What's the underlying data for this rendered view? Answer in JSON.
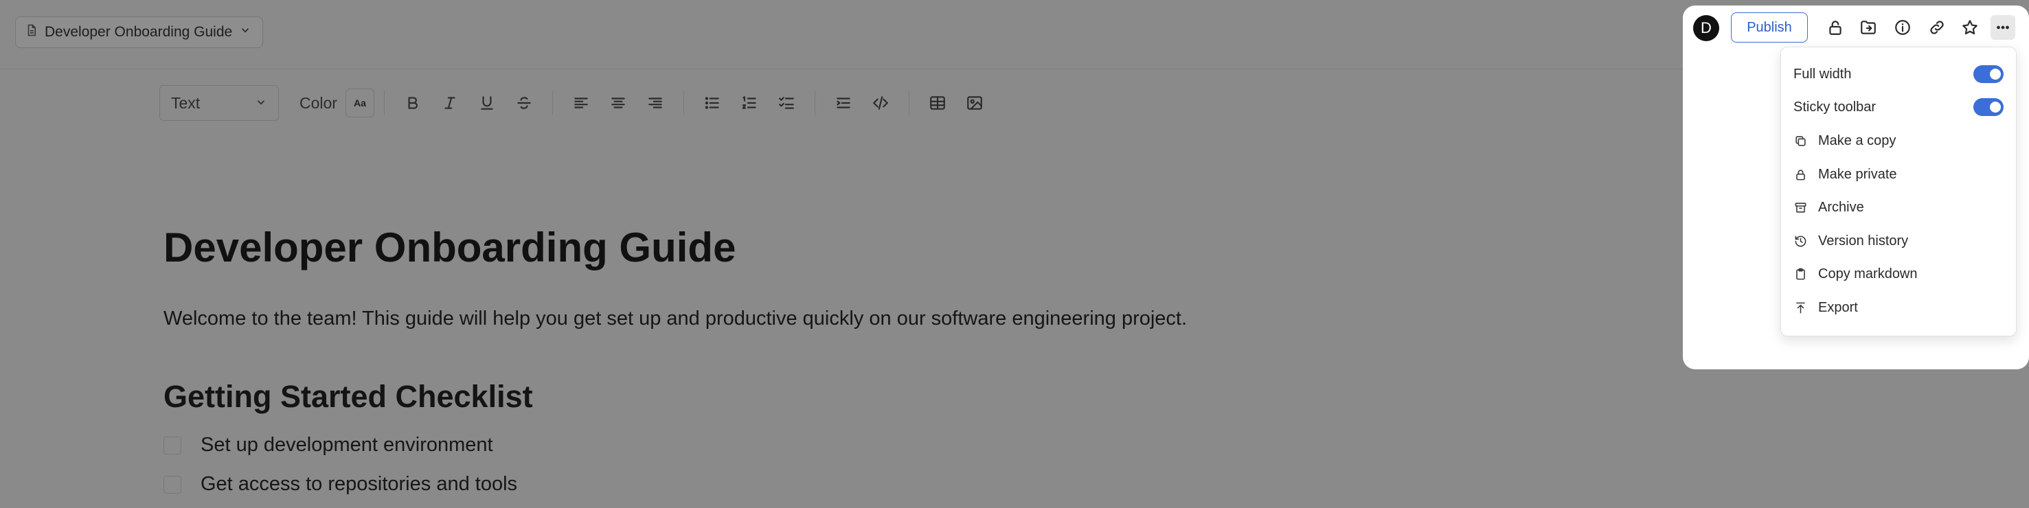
{
  "header": {
    "doc_selector": "Developer Onboarding Guide",
    "avatar_initial": "D",
    "publish_label": "Publish"
  },
  "toolbar": {
    "block_type": "Text",
    "color_label": "Color",
    "color_button": "Aa"
  },
  "document": {
    "title": "Developer Onboarding Guide",
    "intro": "Welcome to the team! This guide will help you get set up and productive quickly on our software engineering project.",
    "section_heading": "Getting Started Checklist",
    "checklist": [
      "Set up development environment",
      "Get access to repositories and tools"
    ]
  },
  "menu": {
    "full_width": "Full width",
    "sticky_toolbar": "Sticky toolbar",
    "make_copy": "Make a copy",
    "make_private": "Make private",
    "archive": "Archive",
    "version_history": "Version history",
    "copy_markdown": "Copy markdown",
    "export": "Export"
  },
  "colors": {
    "accent": "#3b6ed6",
    "overlay": "#8a8a8a"
  }
}
